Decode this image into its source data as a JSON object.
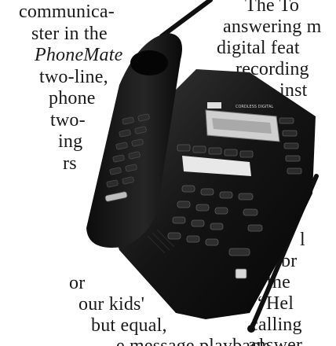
{
  "left_column": {
    "lines": [
      " communica-",
      "ster in the",
      "PhoneMate",
      "two-line,",
      "phone",
      "two-",
      "ing",
      "rs",
      "or",
      "our kids'",
      "but   equal,"
    ]
  },
  "right_column": {
    "lines": [
      "The    To",
      "answering m",
      "digital   feat",
      "recording",
      "inst",
      "l",
      "br",
      "the",
      "“Hel",
      "calling",
      "answer"
    ]
  },
  "bottom_partial": "e  message  playback",
  "phone": {
    "lcd_text": "CORDLESS DIGITAL",
    "brand_badge": "PhoneMate",
    "colors": {
      "body": "#141414",
      "highlight": "#3a3a3a",
      "key": "#2a2a2a",
      "key_text": "#cfcfcf",
      "lcd": "#d9d9d9"
    }
  }
}
